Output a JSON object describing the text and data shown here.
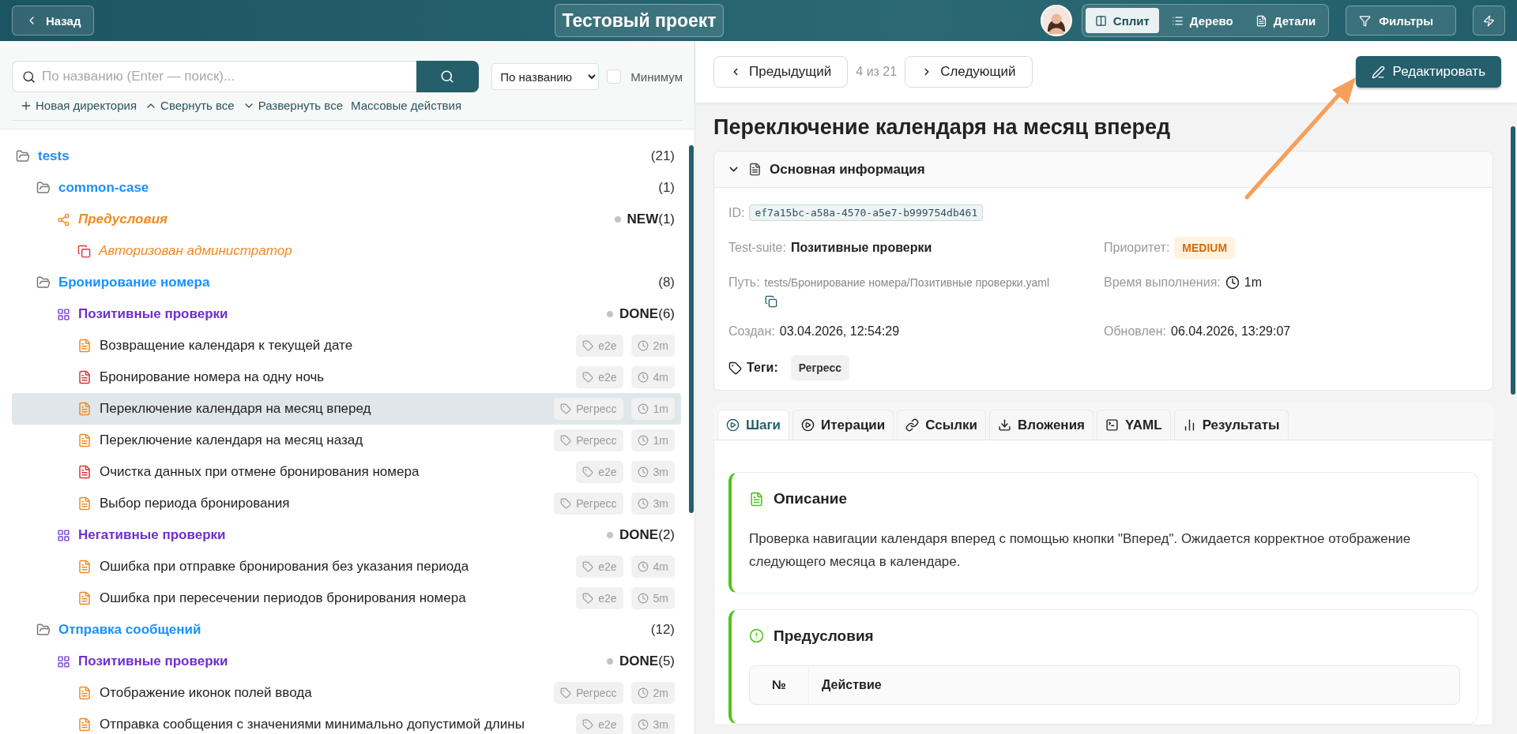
{
  "header": {
    "back_button": "Назад",
    "project_title": "Тестовый проект",
    "view_modes": [
      {
        "label": "Сплит",
        "kind": "split",
        "selected": true
      },
      {
        "label": "Дерево",
        "kind": "tree",
        "selected": false
      },
      {
        "label": "Детали",
        "kind": "details",
        "selected": false
      }
    ],
    "filters_button": "Фильтры"
  },
  "search": {
    "placeholder": "По названию (Enter — поиск)...",
    "sort": "По названию",
    "minimum": {
      "label": "Минимум",
      "checked": false
    }
  },
  "tree_actions": [
    {
      "label": "Новая директория",
      "kind": "add"
    },
    {
      "label": "Свернуть все",
      "kind": "collapse"
    },
    {
      "label": "Развернуть все",
      "kind": "expand"
    },
    {
      "label": "Массовые действия",
      "kind": "plain"
    }
  ],
  "tree": [
    {
      "kind": "folder",
      "name": "tests",
      "count": "(21)",
      "children": [
        {
          "kind": "folder",
          "name": "common-case",
          "count": "(1)",
          "children": [
            {
              "kind": "precondition_group",
              "name": "Предусловия",
              "status": "NEW",
              "count": "(1)",
              "children": [
                {
                  "kind": "precondition",
                  "name": "Авторизован администратор"
                }
              ]
            }
          ]
        },
        {
          "kind": "folder",
          "name": "Бронирование номера",
          "count": "(8)",
          "children": [
            {
              "kind": "suite",
              "name": "Позитивные проверки",
              "status": "DONE",
              "count": "(6)",
              "children": [
                {
                  "kind": "test",
                  "name": "Возвращение календаря к текущей дате",
                  "color": "#f08a24",
                  "tag": "e2e",
                  "duration": "2m",
                  "selected": false
                },
                {
                  "kind": "test",
                  "name": "Бронирование номера на одну ночь",
                  "color": "#d9363e",
                  "tag": "e2e",
                  "duration": "4m",
                  "selected": false
                },
                {
                  "kind": "test",
                  "name": "Переключение календаря на месяц вперед",
                  "color": "#f08a24",
                  "tag": "Регресс",
                  "duration": "1m",
                  "selected": true
                },
                {
                  "kind": "test",
                  "name": "Переключение календаря на месяц назад",
                  "color": "#f08a24",
                  "tag": "Регресс",
                  "duration": "1m",
                  "selected": false
                },
                {
                  "kind": "test",
                  "name": "Очистка данных при отмене бронирования номера",
                  "color": "#d9363e",
                  "tag": "e2e",
                  "duration": "3m",
                  "selected": false
                },
                {
                  "kind": "test",
                  "name": "Выбор периода бронирования",
                  "color": "#f08a24",
                  "tag": "Регресс",
                  "duration": "3m",
                  "selected": false
                }
              ]
            },
            {
              "kind": "suite",
              "name": "Негативные проверки",
              "status": "DONE",
              "count": "(2)",
              "children": [
                {
                  "kind": "test",
                  "name": "Ошибка при отправке бронирования без указания периода",
                  "color": "#f08a24",
                  "tag": "e2e",
                  "duration": "4m",
                  "selected": false
                },
                {
                  "kind": "test",
                  "name": "Ошибка при пересечении периодов бронирования номера",
                  "color": "#f08a24",
                  "tag": "e2e",
                  "duration": "5m",
                  "selected": false
                }
              ]
            }
          ]
        },
        {
          "kind": "folder",
          "name": "Отправка сообщений",
          "count": "(12)",
          "children": [
            {
              "kind": "suite",
              "name": "Позитивные проверки",
              "status": "DONE",
              "count": "(5)",
              "children": [
                {
                  "kind": "test",
                  "name": "Отображение иконок полей ввода",
                  "color": "#f08a24",
                  "tag": "Регресс",
                  "duration": "2m",
                  "selected": false
                },
                {
                  "kind": "test",
                  "name": "Отправка сообщения с значениями минимально допустимой длины",
                  "color": "#f08a24",
                  "tag": "e2e",
                  "duration": "3m",
                  "selected": false
                }
              ]
            }
          ]
        }
      ]
    }
  ],
  "detail": {
    "nav": {
      "prev": "Предыдущий",
      "position": "4 из 21",
      "next": "Следующий",
      "edit": "Редактировать"
    },
    "title": "Переключение календаря на месяц вперед",
    "info": {
      "heading": "Основная информация",
      "expanded": true,
      "rows": [
        {
          "left": {
            "label": "ID:",
            "value": "ef7a15bc-a58a-4570-a5e7-b999754db461",
            "kind": "code"
          }
        },
        {
          "left": {
            "label": "Test-suite:",
            "value": "Позитивные проверки",
            "kind": "strong"
          },
          "right": {
            "label": "Приоритет:",
            "value": "MEDIUM",
            "kind": "badge"
          }
        },
        {
          "left": {
            "label": "Путь:",
            "value": "tests/Бронирование номера/Позитивные проверки.yaml",
            "kind": "path"
          },
          "right": {
            "label": "Время выполнения:",
            "value": "1m",
            "kind": "duration"
          }
        },
        {
          "left": {
            "label": "Создан:",
            "value": "03.04.2026, 12:54:29",
            "kind": "text"
          },
          "right": {
            "label": "Обновлен:",
            "value": "06.04.2026, 13:29:07",
            "kind": "text"
          }
        }
      ],
      "tags": {
        "label": "Теги:",
        "items": [
          "Регресс"
        ]
      }
    },
    "tabs": [
      {
        "label": "Шаги",
        "kind": "steps",
        "selected": true
      },
      {
        "label": "Итерации",
        "kind": "iterations",
        "selected": false
      },
      {
        "label": "Ссылки",
        "kind": "links",
        "selected": false
      },
      {
        "label": "Вложения",
        "kind": "attachments",
        "selected": false
      },
      {
        "label": "YAML",
        "kind": "yaml",
        "selected": false
      },
      {
        "label": "Результаты",
        "kind": "results",
        "selected": false
      }
    ],
    "sections": [
      {
        "kind": "description",
        "title": "Описание",
        "text": "Проверка навигации календаря вперед с помощью кнопки \"Вперед\". Ожидается корректное отображение следующего месяца в календаре."
      },
      {
        "kind": "preconditions",
        "title": "Предусловия",
        "columns": [
          "№",
          "Действие"
        ]
      }
    ]
  }
}
